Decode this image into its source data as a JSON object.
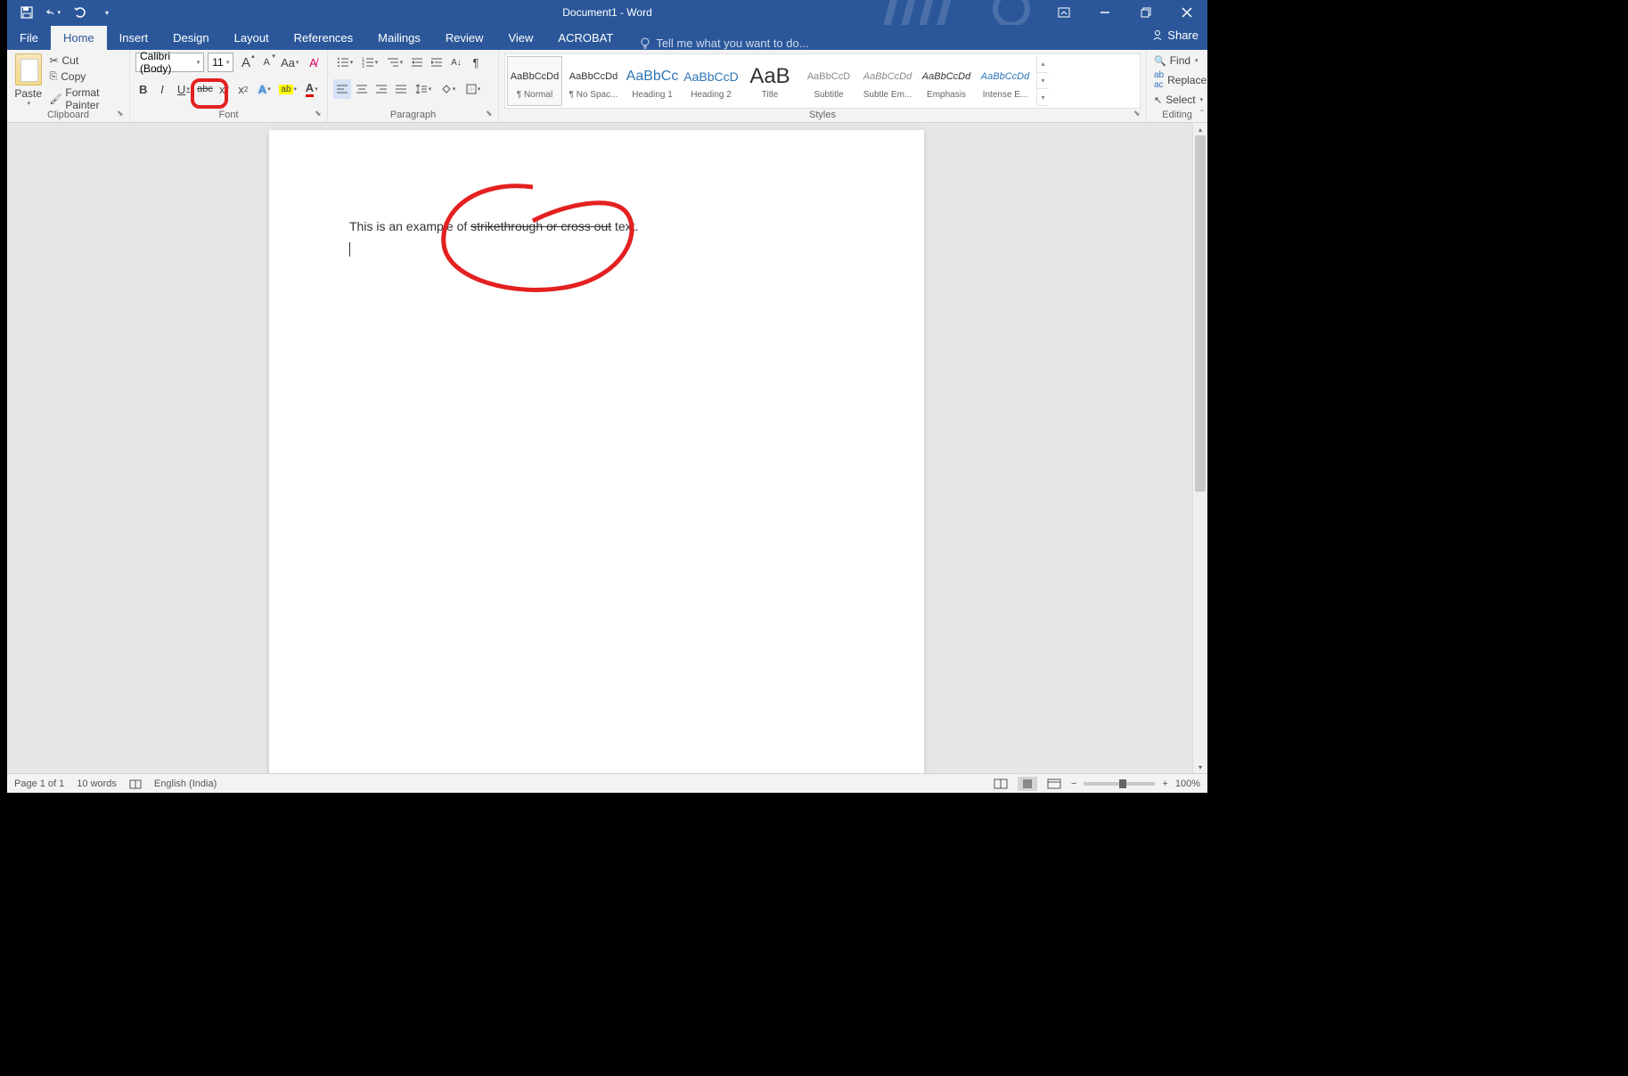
{
  "title": "Document1 - Word",
  "qat": {
    "save": "save-icon",
    "undo": "undo-icon",
    "redo": "redo-icon",
    "customize": "customize-qat"
  },
  "winbtns": {
    "ribbon_opts": "ribbon-display-options",
    "min": "minimize",
    "max": "restore",
    "close": "close"
  },
  "tabs": [
    "File",
    "Home",
    "Insert",
    "Design",
    "Layout",
    "References",
    "Mailings",
    "Review",
    "View",
    "ACROBAT"
  ],
  "active_tab": 1,
  "tellme": "Tell me what you want to do...",
  "share": "Share",
  "clipboard": {
    "label": "Clipboard",
    "paste": "Paste",
    "cut": "Cut",
    "copy": "Copy",
    "fp": "Format Painter"
  },
  "font": {
    "label": "Font",
    "name": "Calibri (Body)",
    "size": "11",
    "grow": "A",
    "shrink": "A",
    "case": "Aa",
    "clear": "clear-formatting",
    "bold": "B",
    "italic": "I",
    "underline": "U",
    "strike": "abc",
    "sub": "x",
    "sup": "x",
    "effects": "text-effects",
    "highlight": "highlight",
    "color": "font-color"
  },
  "paragraph": {
    "label": "Paragraph",
    "bullets": "bullets",
    "numbering": "numbering",
    "multilevel": "multilevel",
    "dec": "decrease-indent",
    "inc": "increase-indent",
    "sort": "sort",
    "marks": "show-marks",
    "al": "align-left",
    "ac": "align-center",
    "ar": "align-right",
    "aj": "justify",
    "ls": "line-spacing",
    "shade": "shading",
    "bord": "borders"
  },
  "styles": {
    "label": "Styles",
    "items": [
      {
        "preview": "AaBbCcDd",
        "name": "¶ Normal",
        "cls": "",
        "sel": true
      },
      {
        "preview": "AaBbCcDd",
        "name": "¶ No Spac...",
        "cls": ""
      },
      {
        "preview": "AaBbCc",
        "name": "Heading 1",
        "cls": "h1"
      },
      {
        "preview": "AaBbCcD",
        "name": "Heading 2",
        "cls": "h2"
      },
      {
        "preview": "AaB",
        "name": "Title",
        "cls": "title"
      },
      {
        "preview": "AaBbCcD",
        "name": "Subtitle",
        "cls": "sub"
      },
      {
        "preview": "AaBbCcDd",
        "name": "Subtle Em...",
        "cls": "sem"
      },
      {
        "preview": "AaBbCcDd",
        "name": "Emphasis",
        "cls": "em"
      },
      {
        "preview": "AaBbCcDd",
        "name": "Intense E...",
        "cls": "ie"
      }
    ]
  },
  "editing": {
    "label": "Editing",
    "find": "Find",
    "replace": "Replace",
    "select": "Select"
  },
  "document": {
    "line_prefix": "This is an example of ",
    "line_strike": "strikethrough or cross out",
    "line_suffix": " text."
  },
  "status": {
    "page": "Page 1 of 1",
    "words": "10 words",
    "lang": "English (India)",
    "zoom": "100%"
  }
}
